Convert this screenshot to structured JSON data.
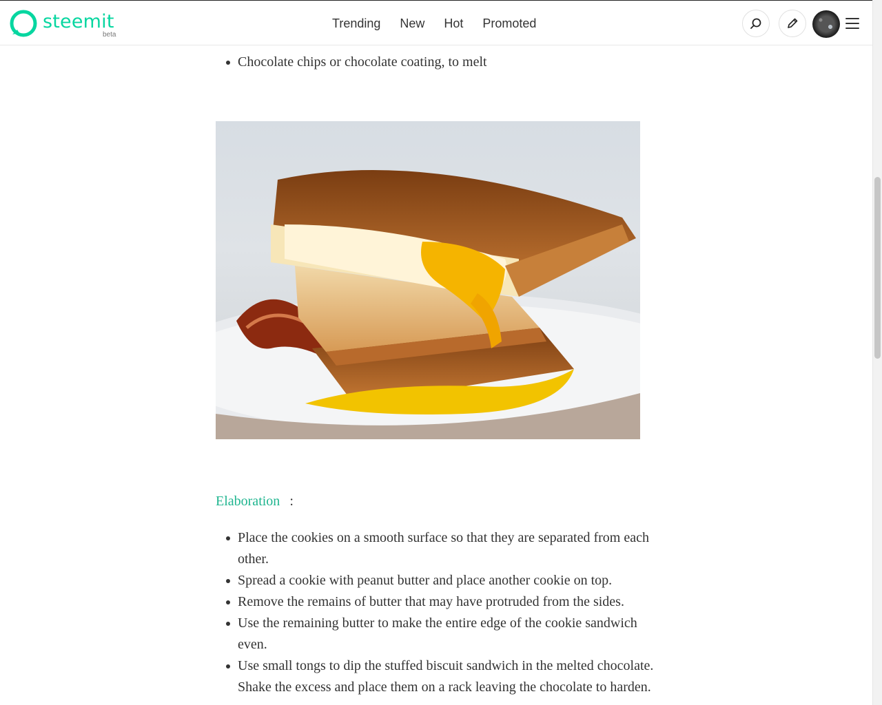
{
  "header": {
    "logo_text": "steemit",
    "logo_badge": "beta",
    "nav": [
      "Trending",
      "New",
      "Hot",
      "Promoted"
    ],
    "brand_color": "#07d6a0",
    "icons": [
      "search-icon",
      "pencil-icon",
      "avatar",
      "menu-icon"
    ]
  },
  "article": {
    "ingredients_tail": [
      "Chocolate chips or chocolate coating, to melt"
    ],
    "image_alt": "grilled cheese sandwich with egg and bacon",
    "section_title": "Elaboration",
    "section_colon": ":",
    "steps": [
      "Place the cookies on a smooth surface so that they are separated from each other.",
      "Spread a cookie with peanut butter and place another cookie on top.",
      "Remove the remains of butter that may have protruded from the sides.",
      "Use the remaining butter to make the entire edge of the cookie sandwich even.",
      "Use small tongs to dip the stuffed biscuit sandwich in the melted chocolate. Shake the excess and place them on a rack leaving the chocolate to harden."
    ],
    "link_color": "#1fb58f"
  }
}
